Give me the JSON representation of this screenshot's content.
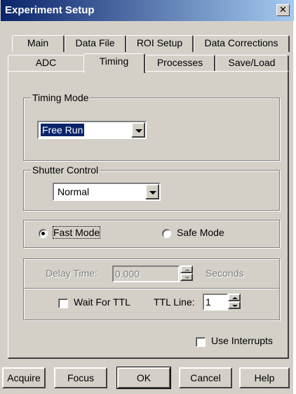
{
  "window": {
    "title": "Experiment Setup",
    "close_glyph": "✕"
  },
  "tabs": {
    "row_back": [
      "Main",
      "Data File",
      "ROI Setup",
      "Data Corrections"
    ],
    "row_front": [
      "ADC",
      "Timing",
      "Processes",
      "Save/Load"
    ],
    "active": "Timing"
  },
  "timing_mode": {
    "group_label": "Timing Mode",
    "value": "Free Run"
  },
  "shutter_control": {
    "group_label": "Shutter Control",
    "value": "Normal"
  },
  "mode": {
    "fast_label": "Fast Mode",
    "safe_label": "Safe Mode",
    "selected": "Fast Mode"
  },
  "delay": {
    "label": "Delay Time:",
    "value": "0.000",
    "unit": "Seconds"
  },
  "ttl": {
    "wait_label": "Wait For TTL",
    "wait_checked": false,
    "line_label": "TTL Line:",
    "line_value": "1"
  },
  "interrupts": {
    "label": "Use Interrupts",
    "checked": false
  },
  "buttons": {
    "acquire": "Acquire",
    "focus": "Focus",
    "ok": "OK",
    "cancel": "Cancel",
    "help": "Help"
  },
  "icons": {
    "close": "close-icon",
    "dropdown": "chevron-down-icon",
    "spin_up": "arrow-up-icon",
    "spin_down": "arrow-down-icon"
  }
}
